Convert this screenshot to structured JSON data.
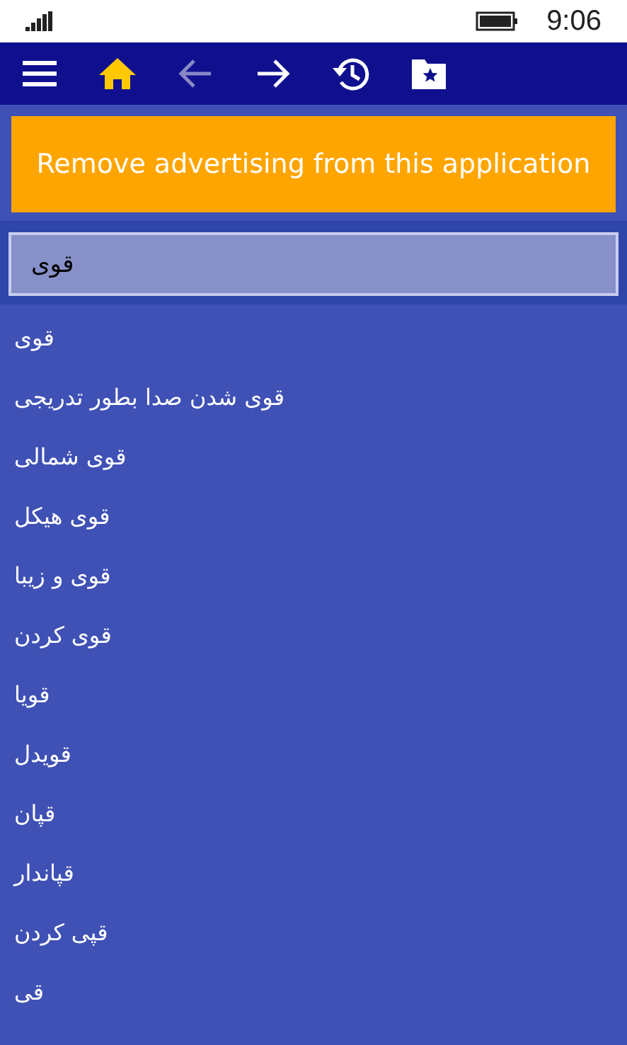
{
  "status_bar": {
    "time": "9:06"
  },
  "toolbar": [
    {
      "kind": "menu",
      "selected": false,
      "disabled": false
    },
    {
      "kind": "home",
      "selected": true,
      "disabled": false
    },
    {
      "kind": "back",
      "selected": false,
      "disabled": true
    },
    {
      "kind": "forward",
      "selected": false,
      "disabled": false
    },
    {
      "kind": "history",
      "selected": false,
      "disabled": false
    },
    {
      "kind": "favorites",
      "selected": false,
      "disabled": false
    }
  ],
  "ad_banner": {
    "label": "Remove advertising from this application"
  },
  "search": {
    "value": "قوی"
  },
  "results": [
    "قوی",
    "قوی شدن صدا بطور تدریجی",
    "قوی شمالی",
    "قوی هیکل",
    "قوی و زیبا",
    "قوی کردن",
    "قویا",
    "قویدل",
    "قپان",
    "قپاندار",
    "قپی کردن",
    "قی"
  ]
}
